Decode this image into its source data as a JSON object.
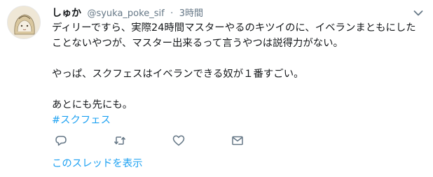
{
  "tweet": {
    "display_name": "しゅか",
    "handle": "@syuka_poke_sif",
    "separator": "·",
    "time": "3時間",
    "lines": [
      "ディリーですら、実際24時間マスターやるのキツイのに、イベランまともにした",
      "ことないやつが、マスター出来るって言うやつは説得力がない。",
      "",
      "やっぱ、スクフェスはイベランできる奴が１番すごい。",
      "",
      "あとにも先にも。"
    ],
    "hashtag": "#スクフェス"
  },
  "actions": {
    "icons": [
      "reply-icon",
      "retweet-icon",
      "like-icon",
      "message-icon"
    ]
  },
  "thread_link": "このスレッドを表示",
  "colors": {
    "link": "#1da1f2",
    "muted": "#657786",
    "text": "#14171a"
  }
}
